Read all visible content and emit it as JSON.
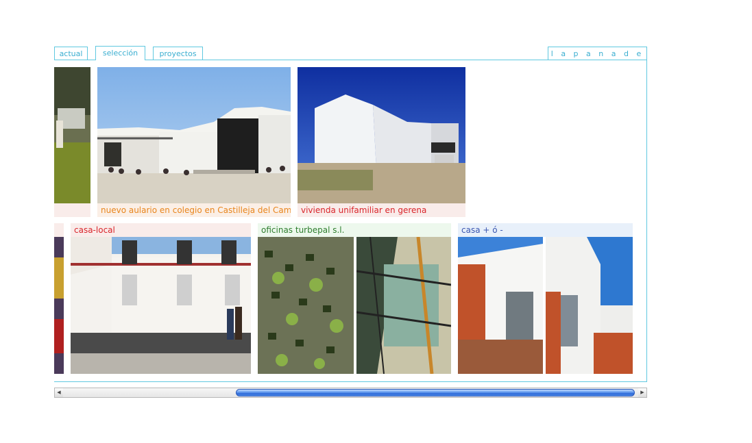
{
  "tabs": [
    {
      "label": "actual",
      "active": false
    },
    {
      "label": "selección",
      "active": true
    },
    {
      "label": "proyectos",
      "active": false
    }
  ],
  "brand": {
    "label": "l a p a n a d e r í a"
  },
  "colors": {
    "accent": "#5fc8e0",
    "caption_orange": "#e8851c",
    "caption_red": "#d9242a",
    "caption_green": "#2e7d2e",
    "caption_blue": "#3a56b0"
  },
  "row1": [
    {
      "caption": ""
    },
    {
      "caption": "nuevo aulario en colegio en Castilleja del Campo"
    },
    {
      "caption": "vivienda unifamiliar en gerena"
    }
  ],
  "row2": [
    {
      "caption": ""
    },
    {
      "caption": "casa-local"
    },
    {
      "caption": "oficinas turbepal s.l."
    },
    {
      "caption": "casa + ó -"
    }
  ],
  "scrollbar": {
    "left_arrow": "◀",
    "right_arrow": "▶"
  }
}
